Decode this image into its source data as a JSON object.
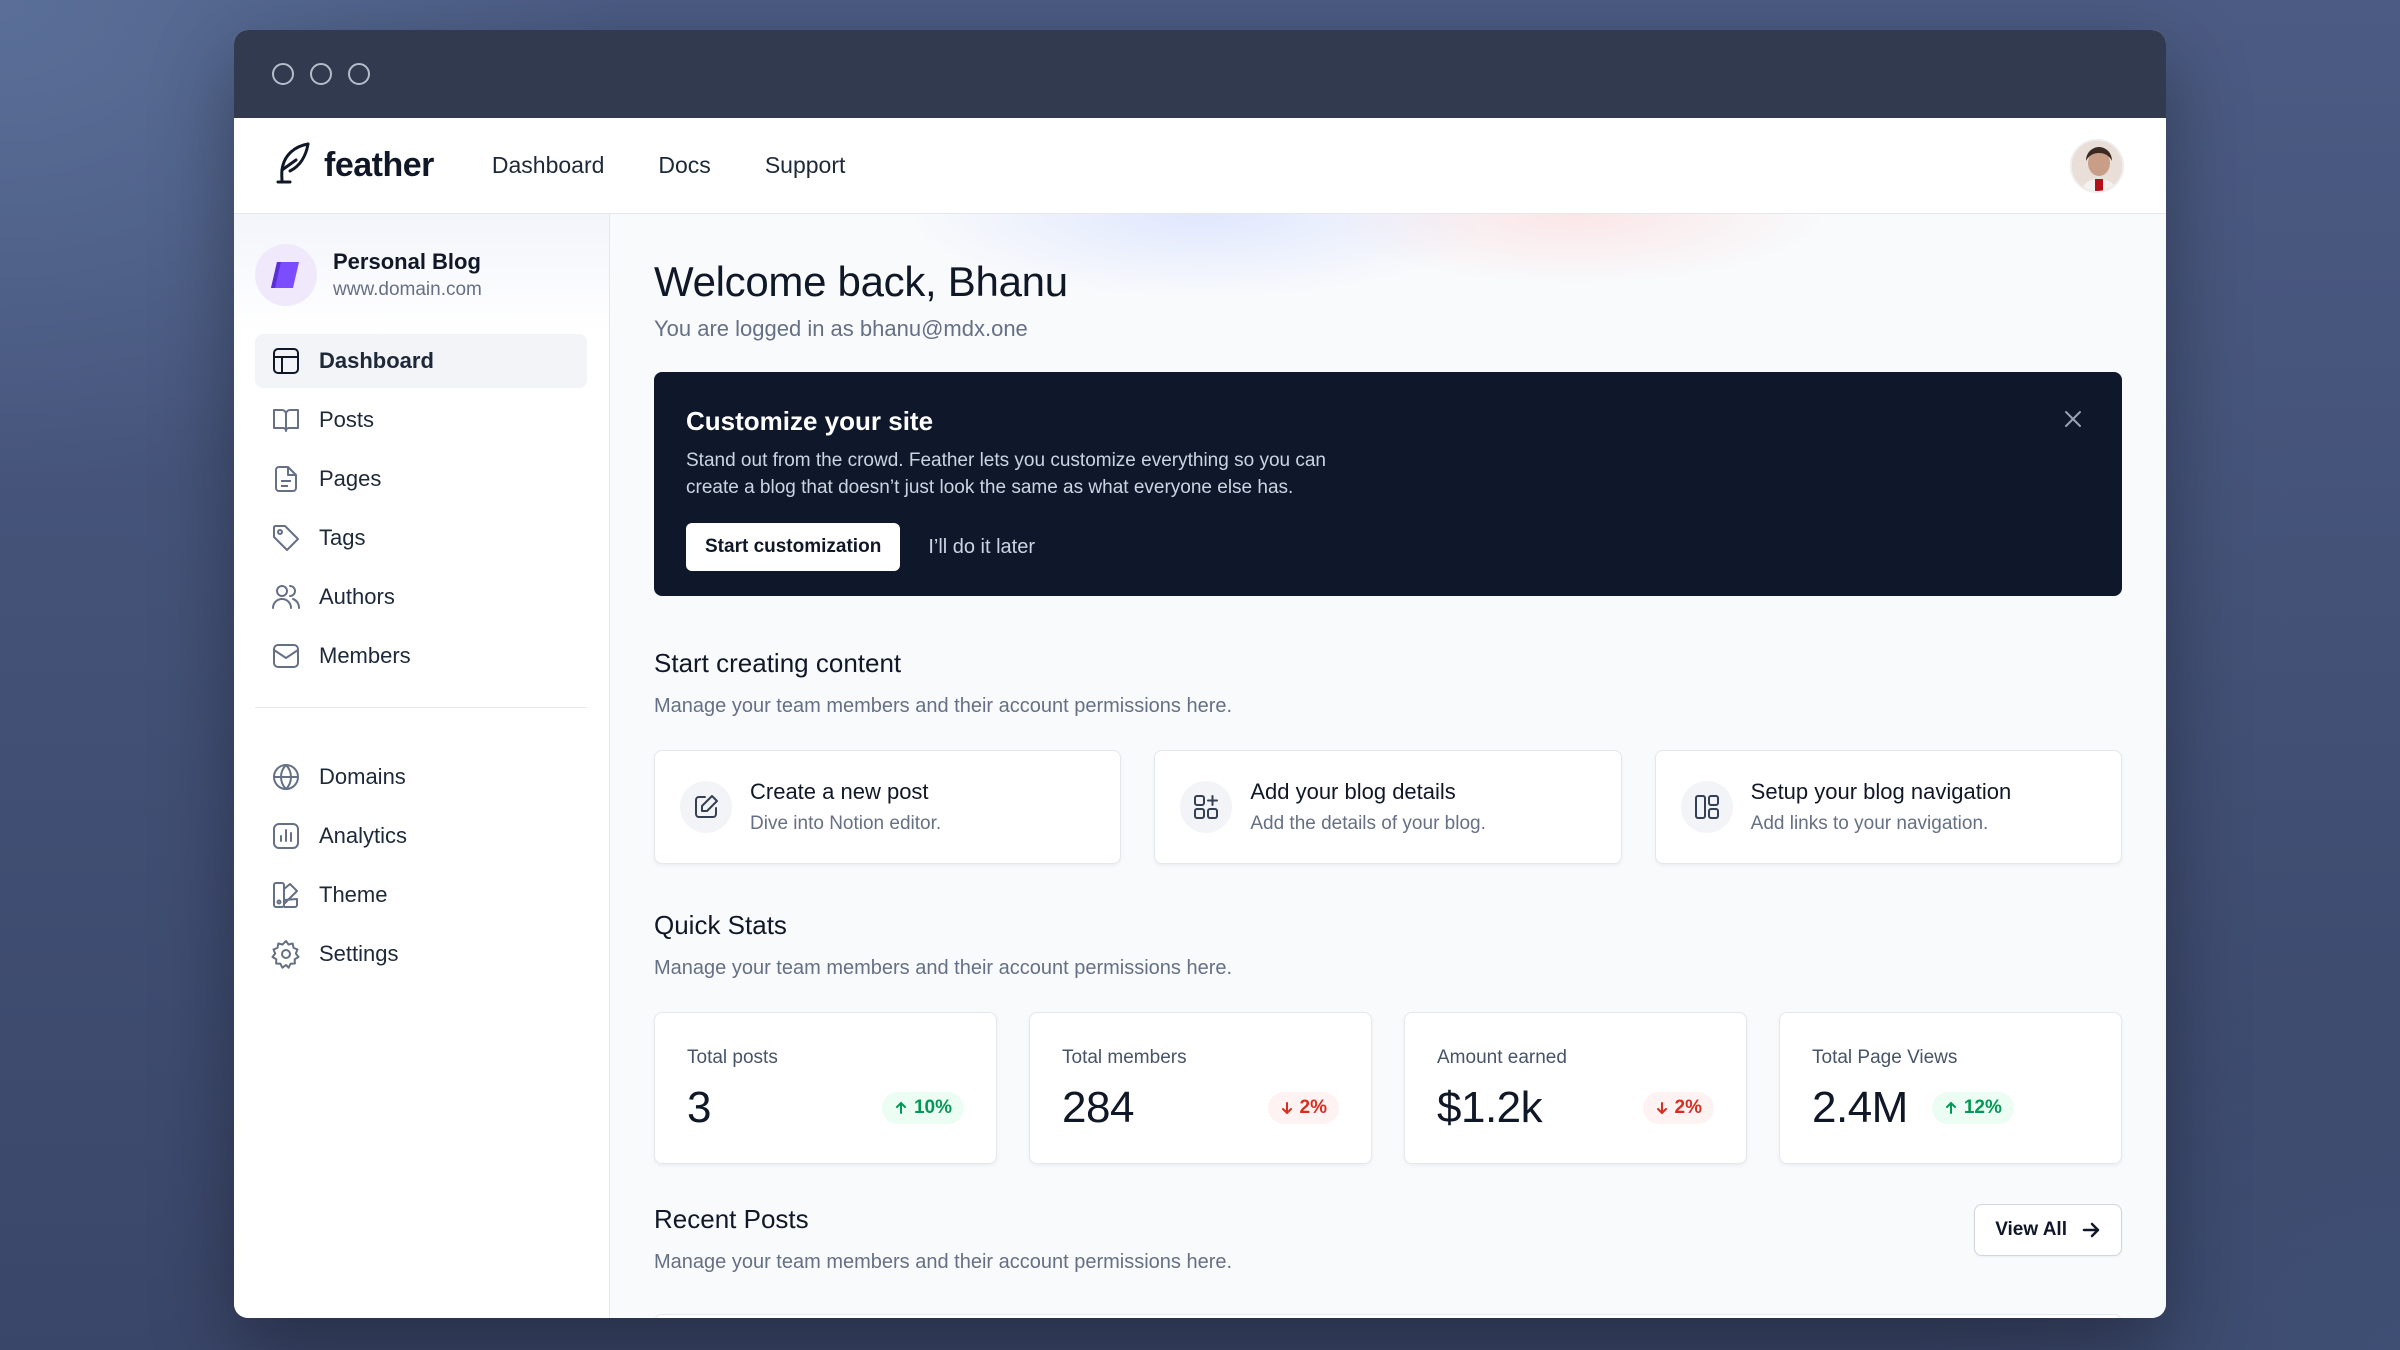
{
  "brand": {
    "name": "feather"
  },
  "topnav": {
    "links": [
      "Dashboard",
      "Docs",
      "Support"
    ]
  },
  "site": {
    "name": "Personal Blog",
    "url": "www.domain.com"
  },
  "sidebar": {
    "primary": [
      {
        "label": "Dashboard",
        "icon": "layout-icon",
        "active": true
      },
      {
        "label": "Posts",
        "icon": "book-icon"
      },
      {
        "label": "Pages",
        "icon": "file-icon"
      },
      {
        "label": "Tags",
        "icon": "tag-icon"
      },
      {
        "label": "Authors",
        "icon": "users-icon"
      },
      {
        "label": "Members",
        "icon": "inbox-icon"
      }
    ],
    "secondary": [
      {
        "label": "Domains",
        "icon": "globe-icon"
      },
      {
        "label": "Analytics",
        "icon": "bar-chart-icon"
      },
      {
        "label": "Theme",
        "icon": "palette-icon"
      },
      {
        "label": "Settings",
        "icon": "gear-icon"
      }
    ]
  },
  "main": {
    "welcome": "Welcome back, Bhanu",
    "subtitle": "You are logged in as bhanu@mdx.one",
    "banner": {
      "title": "Customize your site",
      "description": "Stand out from the crowd. Feather lets you customize everything so you can create a blog that doesn’t just look the same as what everyone else has.",
      "primary": "Start customization",
      "secondary": "I’ll do it later"
    },
    "create": {
      "title": "Start creating content",
      "subtitle": "Manage your team members and their account permissions here.",
      "cards": [
        {
          "title": "Create a new post",
          "subtitle": "Dive into Notion editor.",
          "icon": "edit-icon"
        },
        {
          "title": "Add your blog details",
          "subtitle": "Add the details of your blog.",
          "icon": "grid-plus-icon"
        },
        {
          "title": "Setup your blog navigation",
          "subtitle": "Add links to your navigation.",
          "icon": "columns-icon"
        }
      ]
    },
    "stats": {
      "title": "Quick Stats",
      "subtitle": "Manage your team members and their account permissions here.",
      "items": [
        {
          "label": "Total posts",
          "value": "3",
          "change": "10%",
          "direction": "up"
        },
        {
          "label": "Total members",
          "value": "284",
          "change": "2%",
          "direction": "down"
        },
        {
          "label": "Amount earned",
          "value": "$1.2k",
          "change": "2%",
          "direction": "down"
        },
        {
          "label": "Total Page Views",
          "value": "2.4M",
          "change": "12%",
          "direction": "up"
        }
      ]
    },
    "recent": {
      "title": "Recent Posts",
      "subtitle": "Manage your team members and their account permissions here.",
      "view_all": "View All"
    }
  },
  "colors": {
    "accent": "#7c4dff",
    "dark": "#0f172a",
    "up": "#039855",
    "down": "#d92d20"
  }
}
